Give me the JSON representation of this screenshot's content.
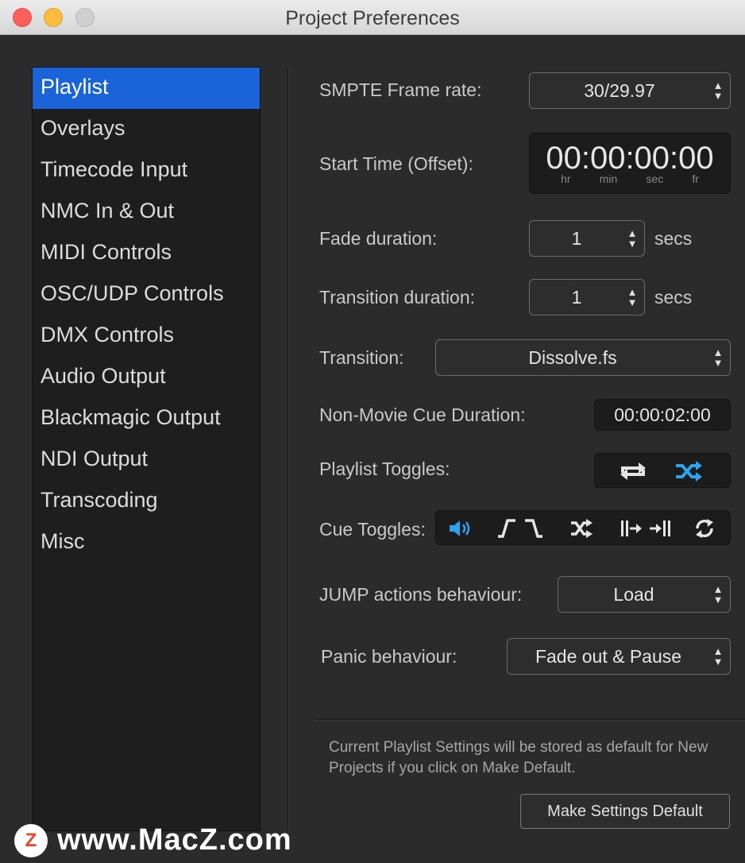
{
  "window": {
    "title": "Project Preferences"
  },
  "sidebar": {
    "items": [
      {
        "label": "Playlist",
        "active": true
      },
      {
        "label": "Overlays"
      },
      {
        "label": "Timecode Input"
      },
      {
        "label": "NMC In & Out"
      },
      {
        "label": "MIDI Controls"
      },
      {
        "label": "OSC/UDP Controls"
      },
      {
        "label": "DMX Controls"
      },
      {
        "label": "Audio Output"
      },
      {
        "label": "Blackmagic Output"
      },
      {
        "label": "NDI Output"
      },
      {
        "label": "Transcoding"
      },
      {
        "label": "Misc"
      }
    ]
  },
  "settings": {
    "smpte": {
      "label": "SMPTE Frame rate:",
      "value": "30/29.97"
    },
    "start_time": {
      "label": "Start Time (Offset):",
      "value": "00:00:00:00",
      "units": [
        "hr",
        "min",
        "sec",
        "fr"
      ]
    },
    "fade": {
      "label": "Fade duration:",
      "value": "1",
      "unit": "secs"
    },
    "transition_duration": {
      "label": "Transition duration:",
      "value": "1",
      "unit": "secs"
    },
    "transition": {
      "label": "Transition:",
      "value": "Dissolve.fs"
    },
    "non_movie": {
      "label": "Non-Movie Cue Duration:",
      "value": "00:00:02:00"
    },
    "playlist_toggles": {
      "label": "Playlist Toggles:",
      "icons": [
        "repeat-icon",
        "shuffle-icon"
      ]
    },
    "cue_toggles": {
      "label": "Cue Toggles:",
      "icons": [
        "volume-icon",
        "fade-in-icon",
        "fade-out-icon",
        "shuffle-icon",
        "skip-in-icon",
        "skip-out-icon",
        "loop-icon"
      ]
    },
    "jump": {
      "label": "JUMP actions behaviour:",
      "value": "Load"
    },
    "panic": {
      "label": "Panic behaviour:",
      "value": "Fade out & Pause"
    }
  },
  "footer": {
    "note": "Current Playlist Settings will be stored as default for New Projects if you click on Make Default.",
    "button": "Make Settings Default"
  },
  "watermark": {
    "logo": "Z",
    "text": "www.MacZ.com"
  },
  "colors": {
    "accent": "#1a63d8",
    "icon_active": "#2ea4f0",
    "icon_inactive": "#e4e4e4"
  }
}
